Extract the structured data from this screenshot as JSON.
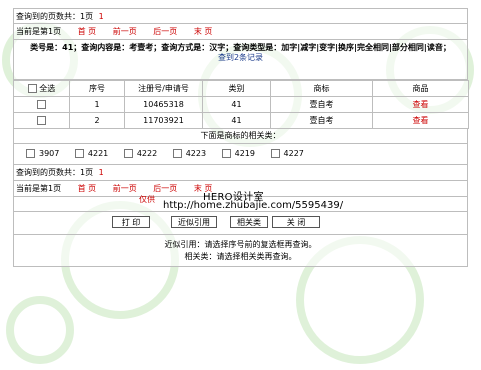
{
  "top": {
    "found_pages_label": "查询到的页数共：1页",
    "found_pages_count": "1",
    "current_page": "当前是第1页",
    "nav": [
      "首 页",
      "前一页",
      "后一页",
      "末 页"
    ]
  },
  "query_info": {
    "line": "类号是：41；查询内容是：考壹考；查询方式是：汉字；查询类型是：加字|减字|变字|换序|完全相同|部分相同|读音；",
    "found_records": "查到2条记录"
  },
  "table": {
    "select_all_label": "全选",
    "headers": [
      "序号",
      "注册号/申请号",
      "类别",
      "商标",
      "商品"
    ],
    "rows": [
      {
        "index": "1",
        "reg_no": "10465318",
        "class": "41",
        "trademark": "壹自考",
        "goods": "查看"
      },
      {
        "index": "2",
        "reg_no": "11703921",
        "class": "41",
        "trademark": "壹自考",
        "goods": "查看"
      }
    ]
  },
  "related": {
    "heading": "下面是商标的相关类：",
    "classes": [
      "3907",
      "4221",
      "4222",
      "4223",
      "4219",
      "4227"
    ]
  },
  "bottom": {
    "found_pages_label": "查询到的页数共：1页",
    "found_pages_count": "1",
    "current_page": "当前是第1页",
    "nav": [
      "首 页",
      "前一页",
      "后一页",
      "末 页"
    ]
  },
  "watermark": {
    "partial_red": "仅供",
    "hero": "HERO设计室",
    "url": "http://home.zhubajie.com/5595439/"
  },
  "buttons": {
    "print": "打 印",
    "similar": "近似引用",
    "related": "相关类",
    "close": "关 闭"
  },
  "notes": {
    "line1": "近似引用：请选择序号前的复选框再查询。",
    "line2": "相关类：请选择相关类再查询。"
  }
}
